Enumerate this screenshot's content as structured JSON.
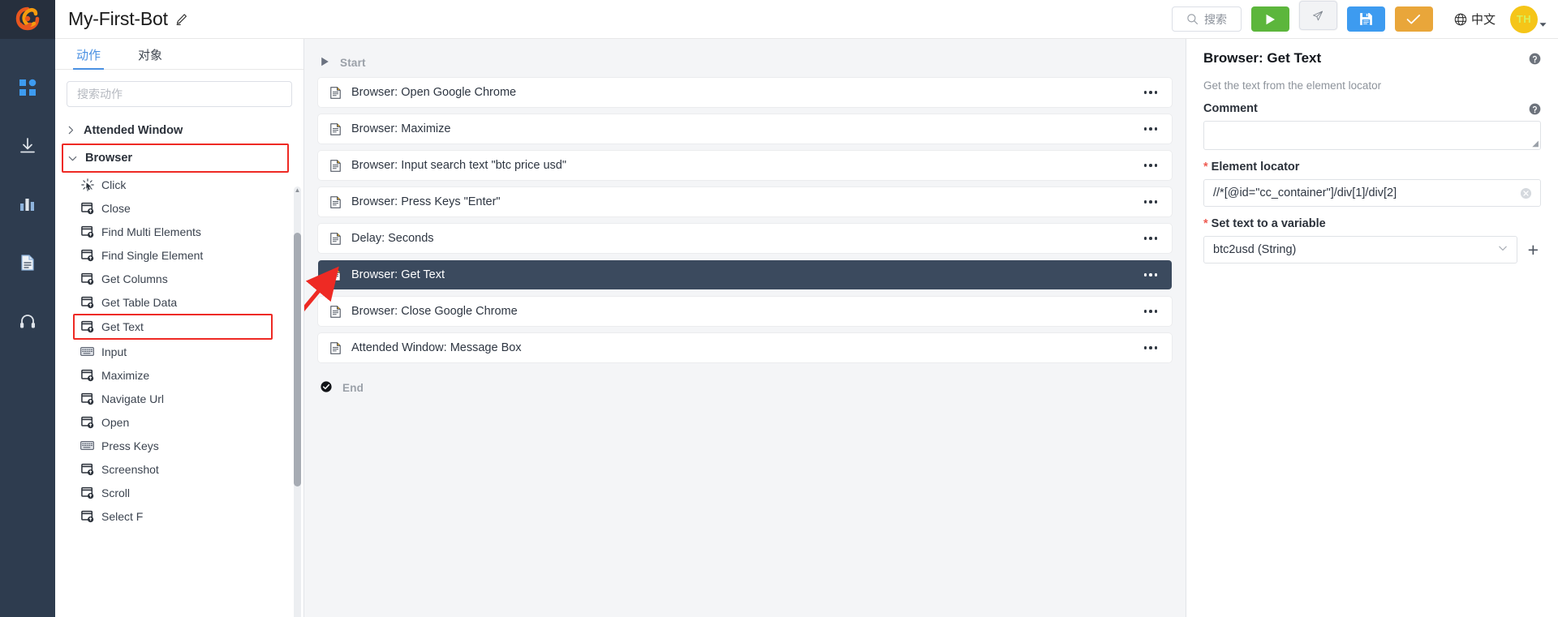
{
  "app": {
    "logo_icon": "app-logo-icon",
    "rail_items": [
      {
        "icon": "dashboard-grid-icon",
        "name": "rail-item-dashboard"
      },
      {
        "icon": "download-icon",
        "name": "rail-item-download"
      },
      {
        "icon": "bar-chart-icon",
        "name": "rail-item-analytics"
      },
      {
        "icon": "document-icon",
        "name": "rail-item-documents"
      },
      {
        "icon": "headset-icon",
        "name": "rail-item-support"
      }
    ]
  },
  "header": {
    "title": "My-First-Bot",
    "edit_icon": "pencil-edit-icon",
    "search": {
      "placeholder": "搜索",
      "icon": "search-icon"
    },
    "buttons": [
      {
        "name": "run-button",
        "icon": "play-icon",
        "color": "#5cb63c"
      },
      {
        "name": "step-run-button",
        "icon": "paper-plane-icon",
        "color": "#f2f3f5"
      },
      {
        "name": "save-button",
        "icon": "floppy-disk-save-icon",
        "color": "#3d9bf0"
      },
      {
        "name": "confirm-button",
        "icon": "checkmark-icon",
        "color": "#e9a63a"
      }
    ],
    "language": {
      "label": "中文",
      "icon": "globe-icon"
    },
    "avatar": {
      "initials": "TH",
      "color": "#f5c518",
      "caret_icon": "caret-down-icon"
    }
  },
  "sidebar": {
    "tabs": [
      {
        "label": "动作",
        "active": true
      },
      {
        "label": "对象",
        "active": false
      }
    ],
    "search_placeholder": "搜索动作",
    "groups": [
      {
        "label": "Attended Window",
        "expanded": false,
        "highlighted": false,
        "chevron": "chevron-right-icon"
      },
      {
        "label": "Browser",
        "expanded": true,
        "highlighted": true,
        "chevron": "chevron-down-icon"
      }
    ],
    "items": [
      {
        "label": "Click",
        "icon": "click-cursor-icon",
        "highlighted": false
      },
      {
        "label": "Close",
        "icon": "browser-window-icon",
        "highlighted": false
      },
      {
        "label": "Find Multi Elements",
        "icon": "browser-window-icon",
        "highlighted": false
      },
      {
        "label": "Find Single Element",
        "icon": "browser-window-icon",
        "highlighted": false
      },
      {
        "label": "Get Columns",
        "icon": "browser-window-icon",
        "highlighted": false
      },
      {
        "label": "Get Table Data",
        "icon": "browser-window-icon",
        "highlighted": false
      },
      {
        "label": "Get Text",
        "icon": "browser-window-icon",
        "highlighted": true
      },
      {
        "label": "Input",
        "icon": "keyboard-icon",
        "highlighted": false
      },
      {
        "label": "Maximize",
        "icon": "browser-window-icon",
        "highlighted": false
      },
      {
        "label": "Navigate Url",
        "icon": "browser-window-icon",
        "highlighted": false
      },
      {
        "label": "Open",
        "icon": "browser-window-icon",
        "highlighted": false
      },
      {
        "label": "Press Keys",
        "icon": "keyboard-icon",
        "highlighted": false
      },
      {
        "label": "Screenshot",
        "icon": "browser-window-icon",
        "highlighted": false
      },
      {
        "label": "Scroll",
        "icon": "browser-window-icon",
        "highlighted": false
      },
      {
        "label": "Select F",
        "icon": "browser-window-icon",
        "highlighted": false
      }
    ],
    "highlight_color": "#ee2a24"
  },
  "canvas": {
    "start_label": "Start",
    "start_icon": "play-triangle-icon",
    "end_label": "End",
    "end_icon": "check-circle-icon",
    "menu_icon": "ellipsis-menu-icon",
    "step_icon": "script-document-icon",
    "selected_color": "#3b4a5e",
    "steps": [
      {
        "label": "Browser: Open Google Chrome",
        "selected": false
      },
      {
        "label": "Browser: Maximize",
        "selected": false
      },
      {
        "label": "Browser: Input search text \"btc price usd\"",
        "selected": false
      },
      {
        "label": "Browser: Press Keys \"Enter\"",
        "selected": false
      },
      {
        "label": "Delay: Seconds",
        "selected": false
      },
      {
        "label": "Browser: Get Text",
        "selected": true
      },
      {
        "label": "Browser: Close Google Chrome",
        "selected": false
      },
      {
        "label": "Attended Window: Message Box",
        "selected": false
      }
    ]
  },
  "properties": {
    "title": "Browser: Get Text",
    "help_icon": "help-circle-icon",
    "description": "Get the text from the element locator",
    "comment": {
      "label": "Comment",
      "value": "",
      "help_icon": "help-circle-icon"
    },
    "element_locator": {
      "label": "Element locator",
      "required": true,
      "value": "//*[@id=\"cc_container\"]/div[1]/div[2]",
      "clear_icon": "clear-circle-icon"
    },
    "variable": {
      "label": "Set text to a variable",
      "required": true,
      "value": "btc2usd (String)",
      "caret_icon": "chevron-down-icon",
      "add_label": "+"
    }
  }
}
